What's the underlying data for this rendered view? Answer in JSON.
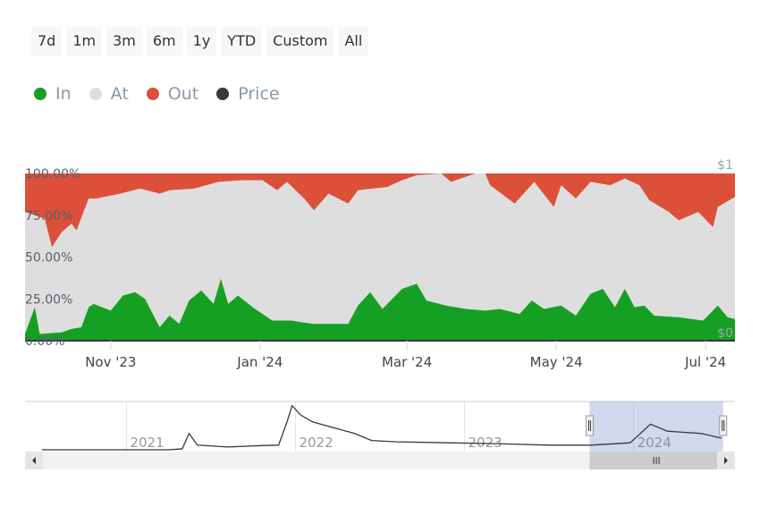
{
  "range_buttons": [
    "7d",
    "1m",
    "3m",
    "6m",
    "1y",
    "YTD",
    "Custom",
    "All"
  ],
  "legend": [
    {
      "label": "In",
      "color": "#16a023"
    },
    {
      "label": "At",
      "color": "#dedede"
    },
    {
      "label": "Out",
      "color": "#dc5039"
    },
    {
      "label": "Price",
      "color": "#333a40"
    }
  ],
  "chart_data": {
    "type": "area",
    "stacking": "percent",
    "x_unit": "days since 2023-09-27",
    "xlim": [
      0,
      290
    ],
    "ylim": [
      0,
      100
    ],
    "y_ticks": [
      "0.00%",
      "25.00%",
      "50.00%",
      "75.00%",
      "100.00%"
    ],
    "y2_ticks": [
      "$0",
      "$1"
    ],
    "x_ticks": [
      {
        "label": "Nov '23",
        "x": 35
      },
      {
        "label": "Jan '24",
        "x": 96
      },
      {
        "label": "Mar '24",
        "x": 156
      },
      {
        "label": "May '24",
        "x": 217
      },
      {
        "label": "Jul '24",
        "x": 278
      }
    ],
    "series": [
      {
        "name": "In",
        "color": "#16a023",
        "points": [
          [
            0,
            4
          ],
          [
            4,
            20
          ],
          [
            6,
            4
          ],
          [
            15,
            5
          ],
          [
            19,
            7
          ],
          [
            23,
            8
          ],
          [
            26,
            20
          ],
          [
            28,
            22
          ],
          [
            35,
            18
          ],
          [
            40,
            27
          ],
          [
            45,
            29
          ],
          [
            49,
            25
          ],
          [
            55,
            8
          ],
          [
            59,
            15
          ],
          [
            63,
            10
          ],
          [
            67,
            24
          ],
          [
            72,
            30
          ],
          [
            77,
            22
          ],
          [
            80,
            37
          ],
          [
            83,
            22
          ],
          [
            87,
            27
          ],
          [
            93,
            20
          ],
          [
            101,
            12
          ],
          [
            109,
            12
          ],
          [
            113,
            11
          ],
          [
            118,
            10
          ],
          [
            124,
            10
          ],
          [
            132,
            10
          ],
          [
            136,
            21
          ],
          [
            141,
            29
          ],
          [
            146,
            19
          ],
          [
            154,
            31
          ],
          [
            160,
            34
          ],
          [
            164,
            24
          ],
          [
            172,
            21
          ],
          [
            180,
            19
          ],
          [
            188,
            18
          ],
          [
            194,
            19
          ],
          [
            202,
            16
          ],
          [
            207,
            24
          ],
          [
            212,
            19
          ],
          [
            219,
            21
          ],
          [
            225,
            15
          ],
          [
            231,
            28
          ],
          [
            236,
            31
          ],
          [
            241,
            20
          ],
          [
            245,
            31
          ],
          [
            249,
            20
          ],
          [
            253,
            21
          ],
          [
            257,
            15
          ],
          [
            267,
            14
          ],
          [
            277,
            12
          ],
          [
            283,
            21
          ],
          [
            287,
            14
          ],
          [
            290,
            13
          ]
        ]
      },
      {
        "name": "In+At",
        "color": "#dedede",
        "points": [
          [
            0,
            77
          ],
          [
            8,
            73
          ],
          [
            11,
            56
          ],
          [
            15,
            65
          ],
          [
            19,
            70
          ],
          [
            21,
            66
          ],
          [
            26,
            85
          ],
          [
            29,
            85
          ],
          [
            39,
            88
          ],
          [
            47,
            91
          ],
          [
            55,
            88
          ],
          [
            59,
            90
          ],
          [
            69,
            91
          ],
          [
            79,
            95
          ],
          [
            89,
            96
          ],
          [
            97,
            96
          ],
          [
            103,
            90
          ],
          [
            107,
            95
          ],
          [
            114,
            85
          ],
          [
            118,
            78
          ],
          [
            124,
            88
          ],
          [
            132,
            82
          ],
          [
            136,
            90
          ],
          [
            148,
            92
          ],
          [
            154,
            96
          ],
          [
            160,
            99
          ],
          [
            170,
            100
          ],
          [
            174,
            95
          ],
          [
            184,
            100
          ],
          [
            188,
            100
          ],
          [
            190,
            93
          ],
          [
            200,
            82
          ],
          [
            208,
            95
          ],
          [
            216,
            80
          ],
          [
            219,
            93
          ],
          [
            225,
            85
          ],
          [
            231,
            95
          ],
          [
            239,
            93
          ],
          [
            245,
            97
          ],
          [
            251,
            93
          ],
          [
            255,
            84
          ],
          [
            263,
            77
          ],
          [
            267,
            72
          ],
          [
            275,
            77
          ],
          [
            281,
            68
          ],
          [
            283,
            80
          ],
          [
            290,
            86
          ]
        ]
      },
      {
        "name": "Out",
        "color": "#dc5039",
        "fill_to": 100
      }
    ]
  },
  "navigator": {
    "years": [
      {
        "label": "2021",
        "x": 2021
      },
      {
        "label": "2022",
        "x": 2022
      },
      {
        "label": "2023",
        "x": 2023
      },
      {
        "label": "2024",
        "x": 2024
      }
    ],
    "xlim": [
      2020.4,
      2024.6
    ],
    "selection": [
      2023.74,
      2024.53
    ],
    "price": [
      [
        2020.5,
        0
      ],
      [
        2021.25,
        0
      ],
      [
        2021.33,
        0.02
      ],
      [
        2021.37,
        0.35
      ],
      [
        2021.42,
        0.1
      ],
      [
        2021.6,
        0.06
      ],
      [
        2021.8,
        0.09
      ],
      [
        2021.9,
        0.1
      ],
      [
        2021.95,
        0.6
      ],
      [
        2021.98,
        0.95
      ],
      [
        2022.03,
        0.75
      ],
      [
        2022.1,
        0.6
      ],
      [
        2022.2,
        0.5
      ],
      [
        2022.35,
        0.35
      ],
      [
        2022.45,
        0.2
      ],
      [
        2022.6,
        0.17
      ],
      [
        2022.9,
        0.15
      ],
      [
        2023.2,
        0.13
      ],
      [
        2023.5,
        0.1
      ],
      [
        2023.75,
        0.1
      ],
      [
        2023.98,
        0.15
      ],
      [
        2024.1,
        0.55
      ],
      [
        2024.2,
        0.4
      ],
      [
        2024.4,
        0.35
      ],
      [
        2024.52,
        0.25
      ]
    ]
  }
}
